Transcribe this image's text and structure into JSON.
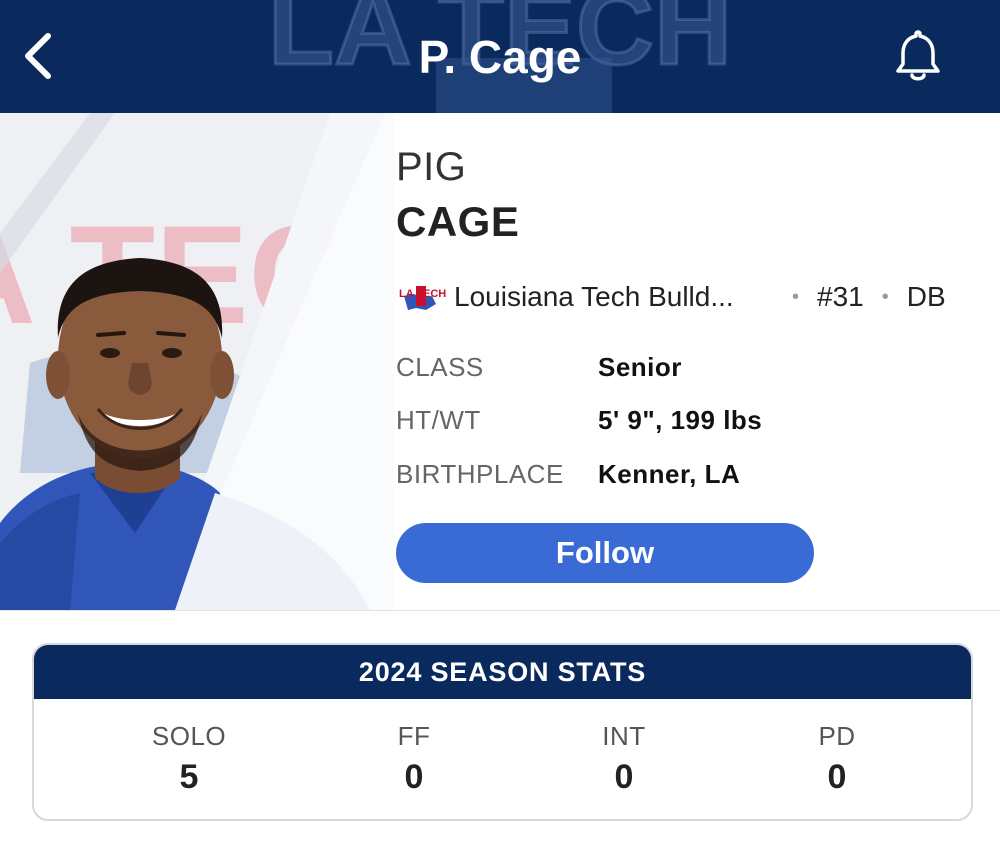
{
  "header": {
    "title": "P. Cage",
    "watermark": "LA TECH",
    "bg_color": "#0a2a5e"
  },
  "player": {
    "first_name": "PIG",
    "last_name": "CAGE",
    "team_logo_text": "LA TECH",
    "team": "Louisiana Tech Bulld...",
    "number": "#31",
    "position": "DB",
    "attributes": [
      {
        "label": "CLASS",
        "value": "Senior"
      },
      {
        "label": "HT/WT",
        "value": "5' 9\", 199 lbs"
      },
      {
        "label": "BIRTHPLACE",
        "value": "Kenner, LA"
      }
    ],
    "photo_watermark": "LA TECH"
  },
  "follow_button": {
    "label": "Follow",
    "color": "#3a6ad4"
  },
  "season_stats": {
    "title": "2024 SEASON STATS",
    "stats": [
      {
        "label": "SOLO",
        "value": "5"
      },
      {
        "label": "FF",
        "value": "0"
      },
      {
        "label": "INT",
        "value": "0"
      },
      {
        "label": "PD",
        "value": "0"
      }
    ]
  },
  "icons": [
    "chevron-left-icon",
    "bell-icon",
    "team-logo-icon"
  ]
}
